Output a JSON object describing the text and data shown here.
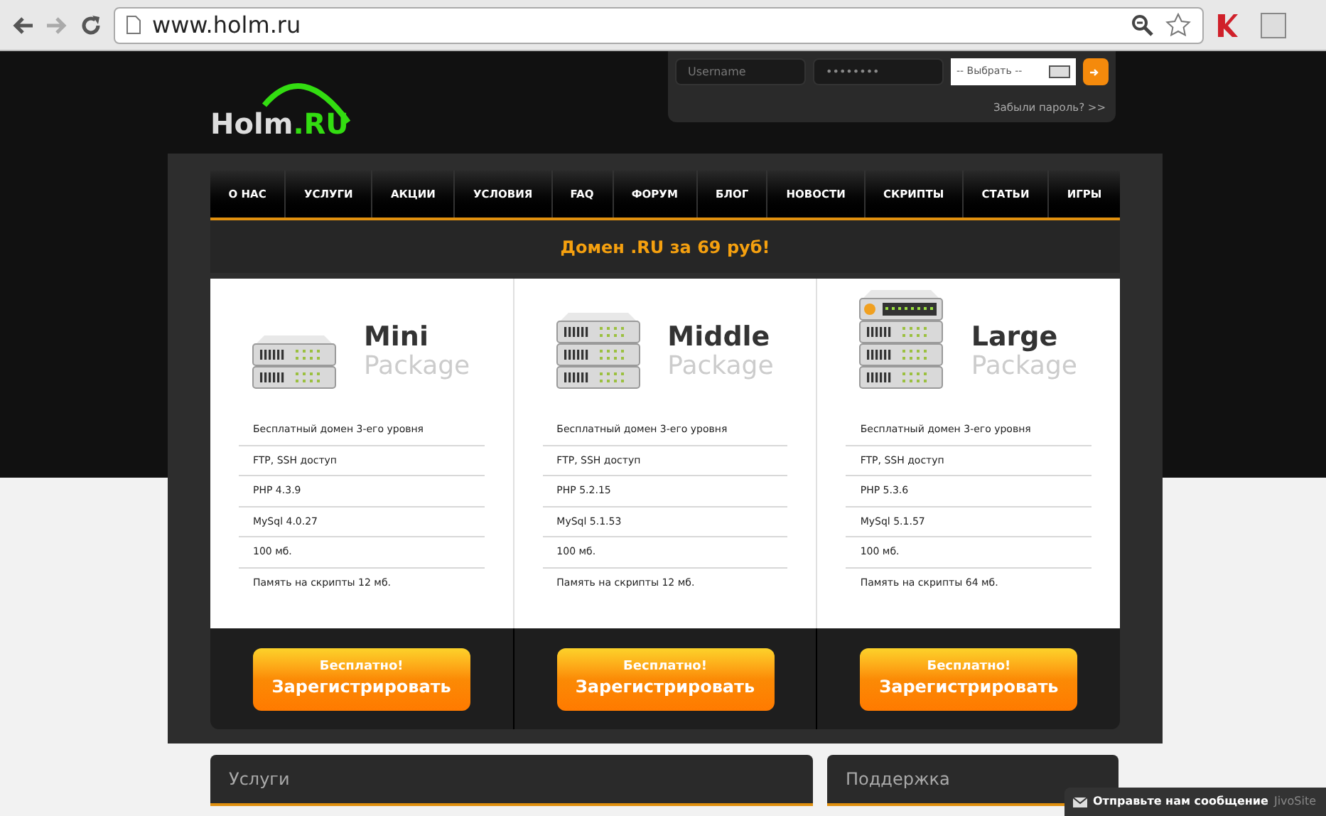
{
  "browser": {
    "url": "www.holm.ru"
  },
  "header": {
    "logo_main": "Holm",
    "logo_suffix": ".RU",
    "login": {
      "username_placeholder": "Username",
      "password_value": "••••••••",
      "select_value": "-- Выбрать --",
      "forgot_link": "Забыли пароль? >>"
    }
  },
  "nav": [
    "О НАС",
    "УСЛУГИ",
    "АКЦИИ",
    "УСЛОВИЯ",
    "FAQ",
    "ФОРУМ",
    "БЛОГ",
    "НОВОСТИ",
    "СКРИПТЫ",
    "СТАТЬИ",
    "ИГРЫ"
  ],
  "banner": "Домен .RU за 69 руб!",
  "plans": [
    {
      "kind": "mini",
      "name": "Mini",
      "subtitle": "Package",
      "features": [
        "Бесплатный домен 3-его уровня",
        "FTP, SSH доступ",
        "PHP 4.3.9",
        "MySql 4.0.27",
        "100 мб.",
        "Память на скрипты 12 мб."
      ],
      "button_top": "Бесплатно!",
      "button_main": "Зарегистрировать"
    },
    {
      "kind": "middle",
      "name": "Middle",
      "subtitle": "Package",
      "features": [
        "Бесплатный домен 3-его уровня",
        "FTP, SSH доступ",
        "PHP 5.2.15",
        "MySql 5.1.53",
        "100 мб.",
        "Память на скрипты 12 мб."
      ],
      "button_top": "Бесплатно!",
      "button_main": "Зарегистрировать"
    },
    {
      "kind": "large",
      "name": "Large",
      "subtitle": "Package",
      "features": [
        "Бесплатный домен 3-его уровня",
        "FTP, SSH доступ",
        "PHP 5.3.6",
        "MySql 5.1.57",
        "100 мб.",
        "Память на скрипты 64 мб."
      ],
      "button_top": "Бесплатно!",
      "button_main": "Зарегистрировать"
    }
  ],
  "bottom_boxes": [
    "Услуги",
    "Поддержка"
  ],
  "chat_widget": {
    "label": "Отправьте нам сообщение",
    "brand": "JivoSite"
  }
}
